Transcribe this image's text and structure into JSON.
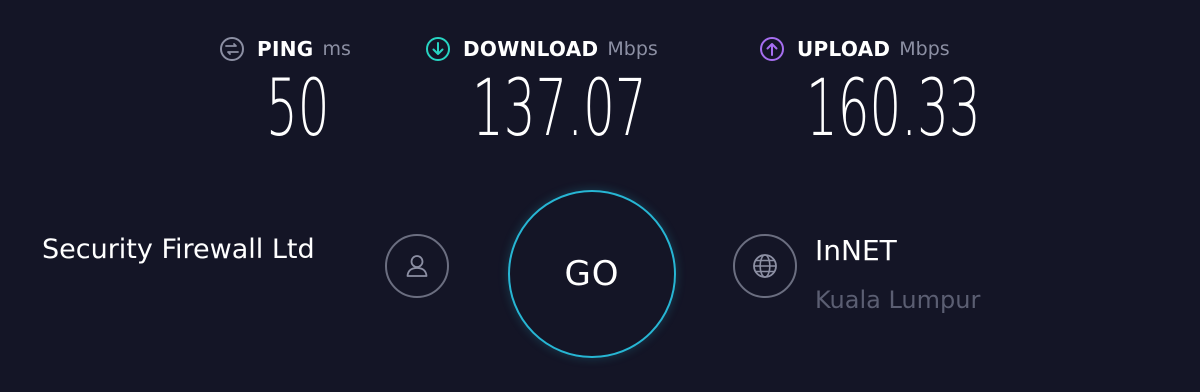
{
  "metrics": {
    "ping": {
      "title": "PING",
      "unit": "ms",
      "value": "50",
      "icon": "ping-icon",
      "color": "#8c8fa3"
    },
    "download": {
      "title": "DOWNLOAD",
      "unit": "Mbps",
      "value": "137.07",
      "icon": "download-arrow-icon",
      "color": "#27d4c2"
    },
    "upload": {
      "title": "UPLOAD",
      "unit": "Mbps",
      "value": "160.33",
      "icon": "upload-arrow-icon",
      "color": "#a66ef0"
    }
  },
  "provider": {
    "name": "Security Firewall Ltd",
    "icon": "user-icon"
  },
  "go_button": {
    "label": "GO",
    "accent": "#27b6d4"
  },
  "server": {
    "name": "InNET",
    "location": "Kuala Lumpur",
    "icon": "globe-icon"
  },
  "colors": {
    "background": "#141526",
    "text": "#ffffff",
    "muted": "#8c8fa3"
  }
}
